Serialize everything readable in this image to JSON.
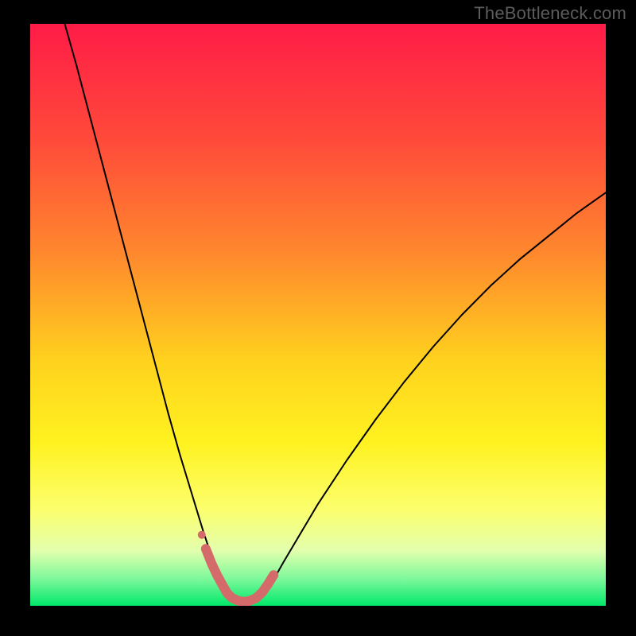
{
  "watermark": {
    "text": "TheBottleneck.com"
  },
  "chart_data": {
    "type": "line",
    "title": "",
    "xlabel": "",
    "ylabel": "",
    "xlim": [
      0,
      100
    ],
    "ylim": [
      0,
      100
    ],
    "annotations": [
      "V-shaped bottleneck curve; minimum near x≈35"
    ],
    "background_gradient_stops": [
      {
        "pos": 0.0,
        "color": "#ff1c47"
      },
      {
        "pos": 0.2,
        "color": "#ff4a3a"
      },
      {
        "pos": 0.4,
        "color": "#ff8a2d"
      },
      {
        "pos": 0.58,
        "color": "#ffd21e"
      },
      {
        "pos": 0.72,
        "color": "#fff220"
      },
      {
        "pos": 0.835,
        "color": "#fcff6e"
      },
      {
        "pos": 0.905,
        "color": "#e3ffad"
      },
      {
        "pos": 0.955,
        "color": "#7af89a"
      },
      {
        "pos": 1.0,
        "color": "#00e86a"
      }
    ],
    "series": [
      {
        "name": "bottleneck-curve",
        "color": "#000000",
        "width": 2,
        "x": [
          6,
          8,
          10,
          12,
          14,
          16,
          18,
          20,
          22,
          24,
          26,
          28,
          30,
          31,
          32,
          33,
          34,
          35,
          36,
          37,
          38,
          39,
          40,
          42,
          44,
          47,
          50,
          55,
          60,
          65,
          70,
          75,
          80,
          85,
          90,
          95,
          100
        ],
        "y": [
          100,
          93,
          85.5,
          78,
          70.5,
          63,
          55.5,
          48,
          40.5,
          33,
          26,
          19.5,
          13,
          10,
          7.5,
          5.2,
          3.3,
          1.8,
          0.8,
          0.3,
          0.3,
          0.7,
          1.5,
          4,
          7.5,
          12.5,
          17.5,
          25,
          32,
          38.5,
          44.5,
          50,
          55,
          59.5,
          63.5,
          67.5,
          71
        ]
      },
      {
        "name": "highlight-band",
        "color": "#d46a6a",
        "width": 12,
        "x": [
          30.5,
          31.5,
          32.5,
          33.5,
          34.2,
          35,
          36,
          37,
          38,
          39.2,
          40.3,
          41.3,
          42.3
        ],
        "y": [
          9.8,
          7.3,
          5.2,
          3.4,
          2.2,
          1.4,
          0.9,
          0.7,
          0.8,
          1.3,
          2.3,
          3.7,
          5.3
        ]
      },
      {
        "name": "highlight-dot",
        "type": "scatter",
        "color": "#d46a6a",
        "radius": 5,
        "x": [
          29.8
        ],
        "y": [
          12.2
        ]
      }
    ]
  }
}
